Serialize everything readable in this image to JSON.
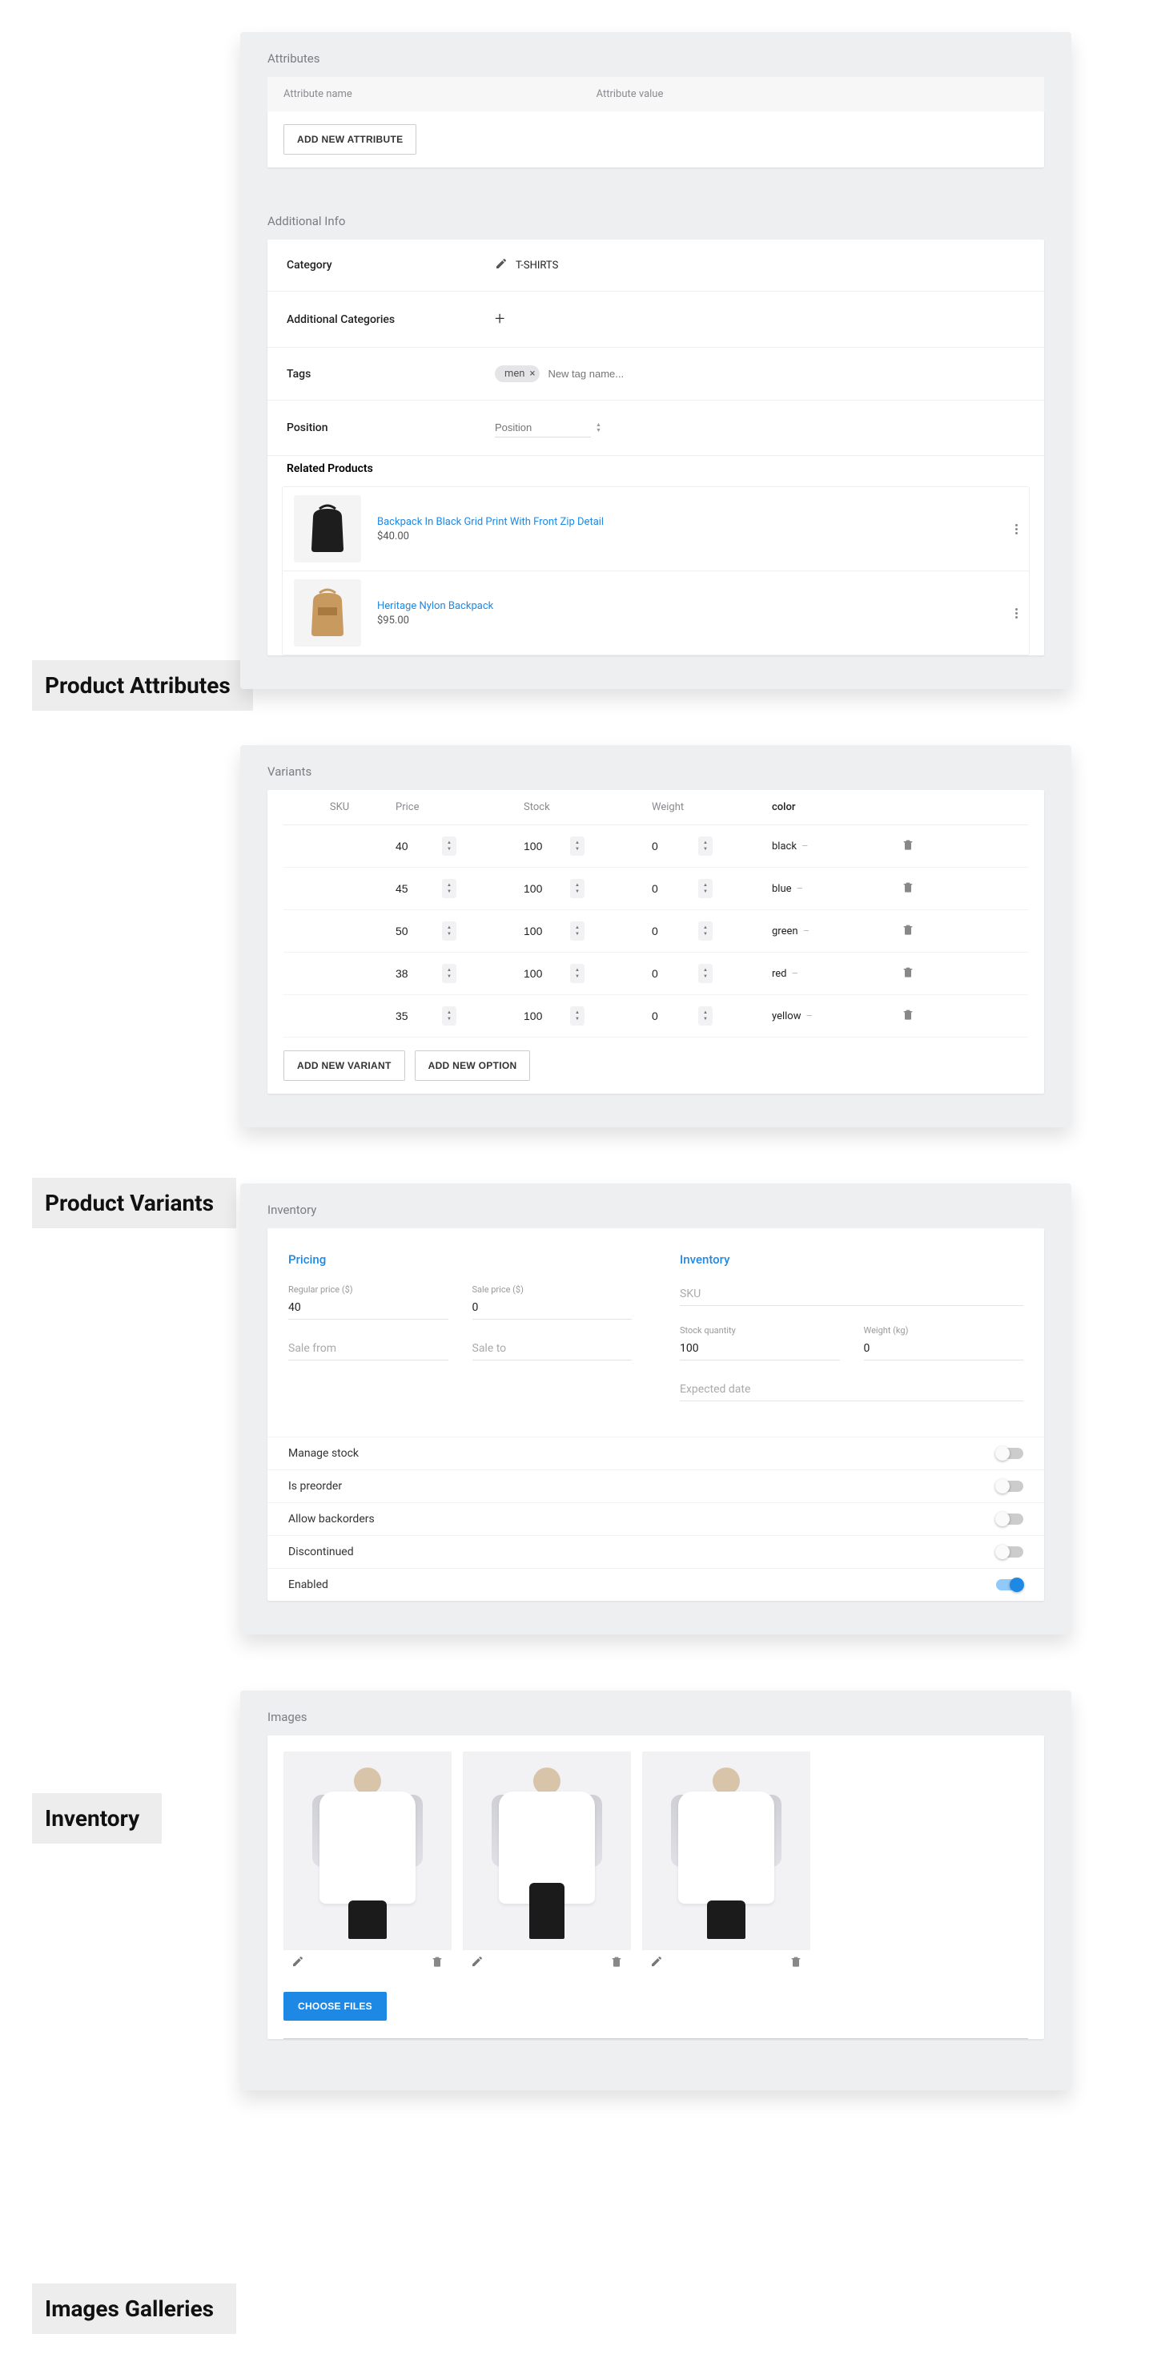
{
  "labels": {
    "product_attributes": "Product Attributes",
    "product_variants": "Product Variants",
    "inventory": "Inventory",
    "images_galleries": "Images Galleries"
  },
  "attributes": {
    "title": "Attributes",
    "col_name": "Attribute name",
    "col_value": "Attribute value",
    "add_btn": "ADD NEW ATTRIBUTE"
  },
  "additional": {
    "title": "Additional Info",
    "category_label": "Category",
    "category_value": "T-SHIRTS",
    "addl_cat_label": "Additional Categories",
    "tags_label": "Tags",
    "tag_chip": "men",
    "tag_placeholder": "New tag name...",
    "position_label": "Position",
    "position_placeholder": "Position",
    "related_label": "Related Products",
    "related": [
      {
        "name": "Backpack In Black Grid Print With Front Zip Detail",
        "price": "$40.00"
      },
      {
        "name": "Heritage Nylon Backpack",
        "price": "$95.00"
      }
    ]
  },
  "variants": {
    "title": "Variants",
    "headers": {
      "sku": "SKU",
      "price": "Price",
      "stock": "Stock",
      "weight": "Weight",
      "color": "color"
    },
    "rows": [
      {
        "price": "40",
        "stock": "100",
        "weight": "0",
        "color": "black"
      },
      {
        "price": "45",
        "stock": "100",
        "weight": "0",
        "color": "blue"
      },
      {
        "price": "50",
        "stock": "100",
        "weight": "0",
        "color": "green"
      },
      {
        "price": "38",
        "stock": "100",
        "weight": "0",
        "color": "red"
      },
      {
        "price": "35",
        "stock": "100",
        "weight": "0",
        "color": "yellow"
      }
    ],
    "add_variant": "ADD NEW VARIANT",
    "add_option": "ADD NEW OPTION"
  },
  "inventory": {
    "title": "Inventory",
    "pricing_hd": "Pricing",
    "inventory_hd": "Inventory",
    "regular_price_label": "Regular price ($)",
    "regular_price": "40",
    "sale_price_label": "Sale price ($)",
    "sale_price": "0",
    "sale_from_label": "Sale from",
    "sale_to_label": "Sale to",
    "sku_label": "SKU",
    "stock_qty_label": "Stock quantity",
    "stock_qty": "100",
    "weight_label": "Weight (kg)",
    "weight": "0",
    "expected_label": "Expected date",
    "toggles": {
      "manage_stock": "Manage stock",
      "preorder": "Is preorder",
      "backorders": "Allow backorders",
      "discontinued": "Discontinued",
      "enabled": "Enabled"
    }
  },
  "images": {
    "title": "Images",
    "choose": "CHOOSE FILES"
  }
}
